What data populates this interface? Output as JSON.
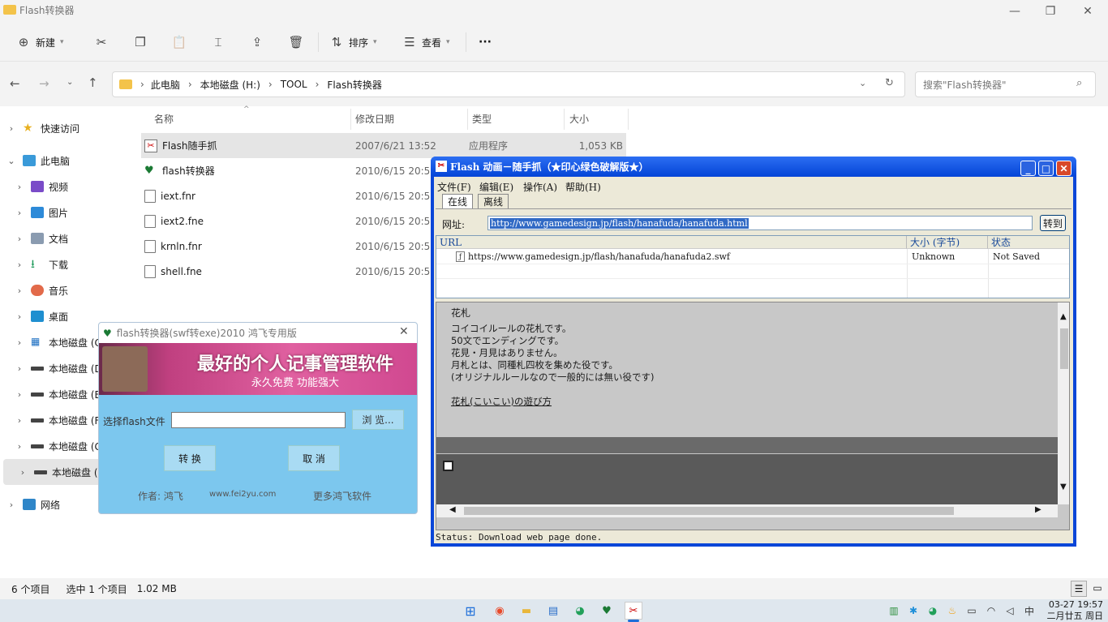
{
  "explorer": {
    "title": "Flash转换器",
    "toolbar": {
      "new_label": "新建",
      "sort_label": "排序",
      "view_label": "查看",
      "more_label": "···"
    },
    "breadcrumb": [
      "此电脑",
      "本地磁盘 (H:)",
      "TOOL",
      "Flash转换器"
    ],
    "search_placeholder": "搜索\"Flash转换器\"",
    "columns": {
      "name": "名称",
      "date": "修改日期",
      "type": "类型",
      "size": "大小"
    },
    "files": [
      {
        "name": "Flash随手抓",
        "date": "2007/6/21 13:52",
        "type": "应用程序",
        "size": "1,053 KB",
        "icon": "flash-grabber-icon"
      },
      {
        "name": "flash转换器",
        "date": "2010/6/15 20:58",
        "type": "",
        "size": "",
        "icon": "flash-converter-icon"
      },
      {
        "name": "iext.fnr",
        "date": "2010/6/15 20:58",
        "type": "",
        "size": "",
        "icon": "file-icon"
      },
      {
        "name": "iext2.fne",
        "date": "2010/6/15 20:58",
        "type": "",
        "size": "",
        "icon": "file-icon"
      },
      {
        "name": "krnln.fnr",
        "date": "2010/6/15 20:58",
        "type": "",
        "size": "",
        "icon": "file-icon"
      },
      {
        "name": "shell.fne",
        "date": "2010/6/15 20:58",
        "type": "",
        "size": "",
        "icon": "file-icon"
      }
    ],
    "sidebar": [
      {
        "label": "快速访问",
        "icon": "star-icon",
        "level": 0
      },
      {
        "label": "此电脑",
        "icon": "computer-icon",
        "level": 0,
        "expanded": true
      },
      {
        "label": "视频",
        "icon": "video-icon",
        "level": 1
      },
      {
        "label": "图片",
        "icon": "picture-icon",
        "level": 1
      },
      {
        "label": "文档",
        "icon": "document-icon",
        "level": 1
      },
      {
        "label": "下载",
        "icon": "download-icon",
        "level": 1
      },
      {
        "label": "音乐",
        "icon": "music-icon",
        "level": 1
      },
      {
        "label": "桌面",
        "icon": "desktop-icon",
        "level": 1
      },
      {
        "label": "本地磁盘 (C",
        "icon": "windows-drive-icon",
        "level": 1
      },
      {
        "label": "本地磁盘 (D",
        "icon": "drive-icon",
        "level": 1
      },
      {
        "label": "本地磁盘 (E",
        "icon": "drive-icon",
        "level": 1
      },
      {
        "label": "本地磁盘 (F",
        "icon": "drive-icon",
        "level": 1
      },
      {
        "label": "本地磁盘 (G",
        "icon": "drive-icon",
        "level": 1
      },
      {
        "label": "本地磁盘 (H",
        "icon": "drive-icon",
        "level": 1,
        "selected": true
      },
      {
        "label": "网络",
        "icon": "network-icon",
        "level": 0
      }
    ],
    "status": {
      "count": "6 个项目",
      "selected": "选中 1 个项目",
      "size": "1.02 MB"
    }
  },
  "grabber": {
    "title": "Flash 动画－随手抓（★印心绿色破解版★）",
    "menu": [
      "文件(F)",
      "编辑(E)",
      "操作(A)",
      "帮助(H)"
    ],
    "tabs": [
      "在线",
      "离线"
    ],
    "url_label": "网址:",
    "url_value": "http://www.gamedesign.jp/flash/hanafuda/hanafuda.html",
    "go_label": "转到",
    "list_headers": {
      "url": "URL",
      "size": "大小 (字节)",
      "state": "状态"
    },
    "list_rows": [
      {
        "url": "https://www.gamedesign.jp/flash/hanafuda/hanafuda2.swf",
        "size": "Unknown",
        "state": "Not Saved"
      }
    ],
    "page": {
      "title": "花札",
      "lines": [
        "コイコイルールの花札です。",
        "50文でエンディングです。",
        "花見・月見はありません。",
        "月札とは、同種札四枚を集めた役です。",
        "(オリジナルルールなので一般的には無い役です)"
      ],
      "link": "花札(こいこい)の遊び方"
    },
    "status": "Status: Download web page done."
  },
  "converter": {
    "title": "flash转换器(swf转exe)2010 鸿飞专用版",
    "banner_title": "最好的个人记事管理软件",
    "banner_sub": "永久免费  功能强大",
    "select_label": "选择flash文件",
    "browse_label": "浏 览...",
    "convert_label": "转 换",
    "cancel_label": "取 消",
    "author": "作者: 鸿飞",
    "website": "www.fei2yu.com",
    "more": "更多鸿飞软件"
  },
  "taskbar": {
    "time": "03-27 19:57",
    "date": "二月廿五 周日",
    "ime": "中"
  },
  "colors": {
    "xp_blue": "#0a46d8",
    "explorer_bg": "#f3f3f3",
    "selection": "#e5e5e5",
    "converter_bg": "#7cc7ee"
  }
}
